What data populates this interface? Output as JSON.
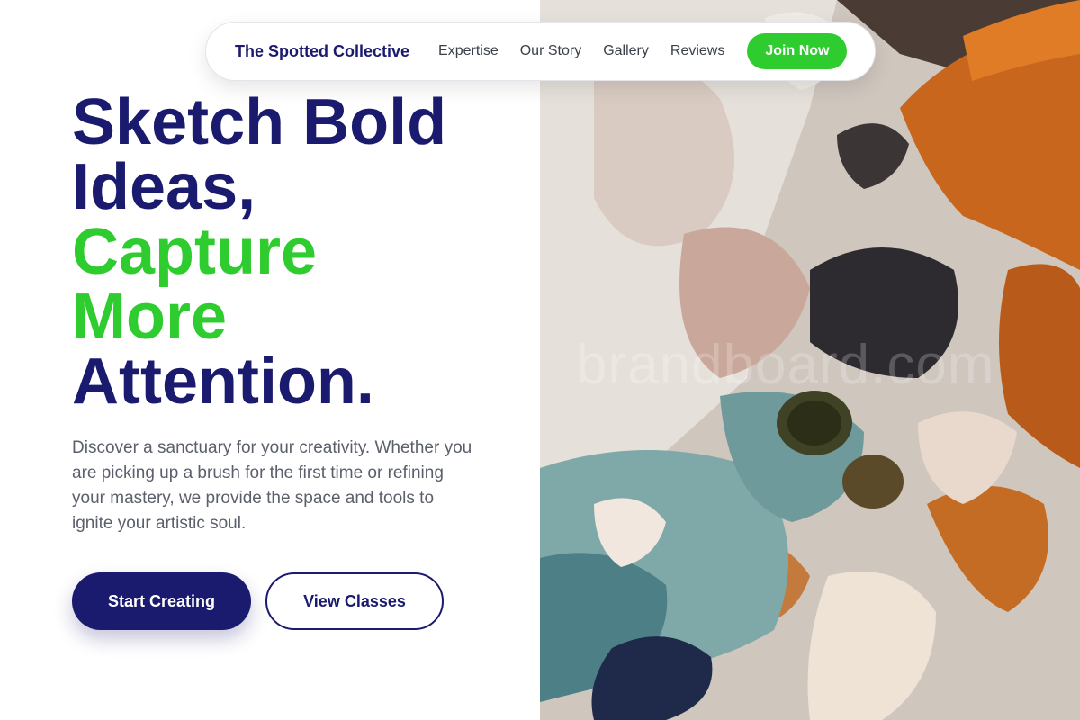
{
  "nav": {
    "brand": "The Spotted Collective",
    "links": [
      "Expertise",
      "Our Story",
      "Gallery",
      "Reviews"
    ],
    "cta": "Join Now"
  },
  "hero": {
    "headline_line1": "Sketch Bold",
    "headline_line2": "Ideas,",
    "headline_line3": "Capture",
    "headline_line4": "More",
    "headline_line5": "Attention.",
    "description": "Discover a sanctuary for your creativity. Whether you are picking up a brush for the first time or refining your mastery, we provide the space and tools to ignite your artistic soul.",
    "primary_button": "Start Creating",
    "secondary_button": "View Classes"
  },
  "artwork": {
    "watermark": "brandboard.com"
  },
  "colors": {
    "navy": "#1a1a6e",
    "green": "#2ecc2e",
    "body_text": "#5a5f6b"
  }
}
